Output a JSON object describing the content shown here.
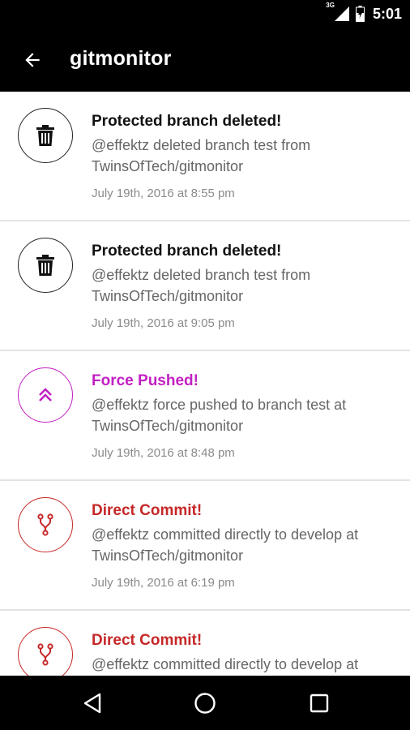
{
  "status_bar": {
    "network": "3G",
    "time": "5:01"
  },
  "app_bar": {
    "title": "gitmonitor",
    "back_icon": "arrow-back-icon"
  },
  "items": [
    {
      "type": "deleted",
      "icon": "trash-icon",
      "color": "#111111",
      "title": "Protected branch deleted!",
      "body": "@effektz deleted branch test from TwinsOfTech/gitmonitor",
      "date": "July 19th, 2016 at 8:55 pm"
    },
    {
      "type": "deleted",
      "icon": "trash-icon",
      "color": "#111111",
      "title": "Protected branch deleted!",
      "body": "@effektz deleted branch test from TwinsOfTech/gitmonitor",
      "date": "July 19th, 2016 at 9:05 pm"
    },
    {
      "type": "force",
      "icon": "double-chevron-up-icon",
      "color": "#c21fc2",
      "title": "Force Pushed!",
      "body": "@effektz force pushed to branch test at TwinsOfTech/gitmonitor",
      "date": "July 19th, 2016 at 8:48 pm"
    },
    {
      "type": "commit",
      "icon": "git-branch-icon",
      "color": "#c62828",
      "title": "Direct Commit!",
      "body": "@effektz committed directly to develop at TwinsOfTech/gitmonitor",
      "date": "July 19th, 2016 at 6:19 pm"
    },
    {
      "type": "commit",
      "icon": "git-branch-icon",
      "color": "#c62828",
      "title": "Direct Commit!",
      "body": "@effektz committed directly to develop at TwinsOfTech/gitmonitor",
      "date": ""
    }
  ],
  "nav_bar": {
    "back": "nav-back-icon",
    "home": "nav-home-icon",
    "recents": "nav-recents-icon"
  }
}
